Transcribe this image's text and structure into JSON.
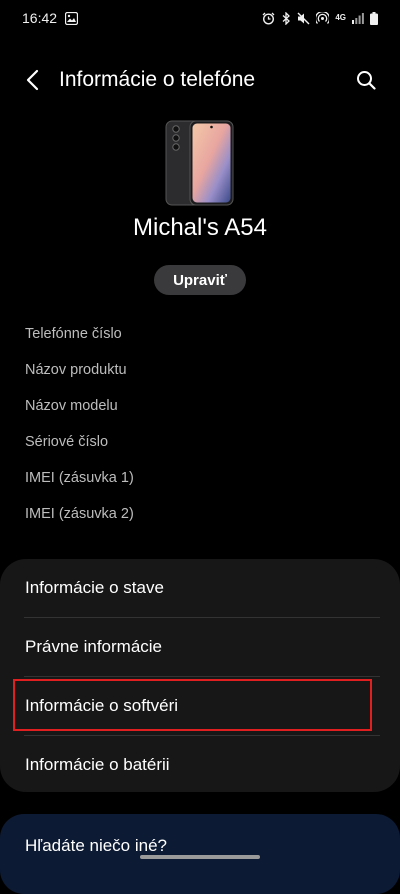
{
  "status_bar": {
    "time": "16:42",
    "network": "4G"
  },
  "header": {
    "title": "Informácie o telefóne"
  },
  "device": {
    "name": "Michal's A54",
    "edit_label": "Upraviť"
  },
  "info_rows": [
    "Telefónne číslo",
    "Názov produktu",
    "Názov modelu",
    "Sériové číslo",
    "IMEI (zásuvka 1)",
    "IMEI (zásuvka 2)"
  ],
  "menu": {
    "items": [
      "Informácie o stave",
      "Právne informácie",
      "Informácie o softvéri",
      "Informácie o batérii"
    ]
  },
  "footer_card": {
    "text": "Hľadáte niečo iné?"
  },
  "colors": {
    "background": "#000000",
    "card": "#171717",
    "edit_button": "#3a3a3c",
    "highlight": "#e02020",
    "secondary_text": "#bdbdbd"
  },
  "icons": {
    "status_left": [
      "gallery-notification-icon"
    ],
    "status_right": [
      "alarm-icon",
      "bluetooth-icon",
      "mute-icon",
      "hotspot-icon",
      "signal-icon",
      "battery-icon"
    ],
    "back": "chevron-left-icon",
    "search": "search-icon"
  }
}
